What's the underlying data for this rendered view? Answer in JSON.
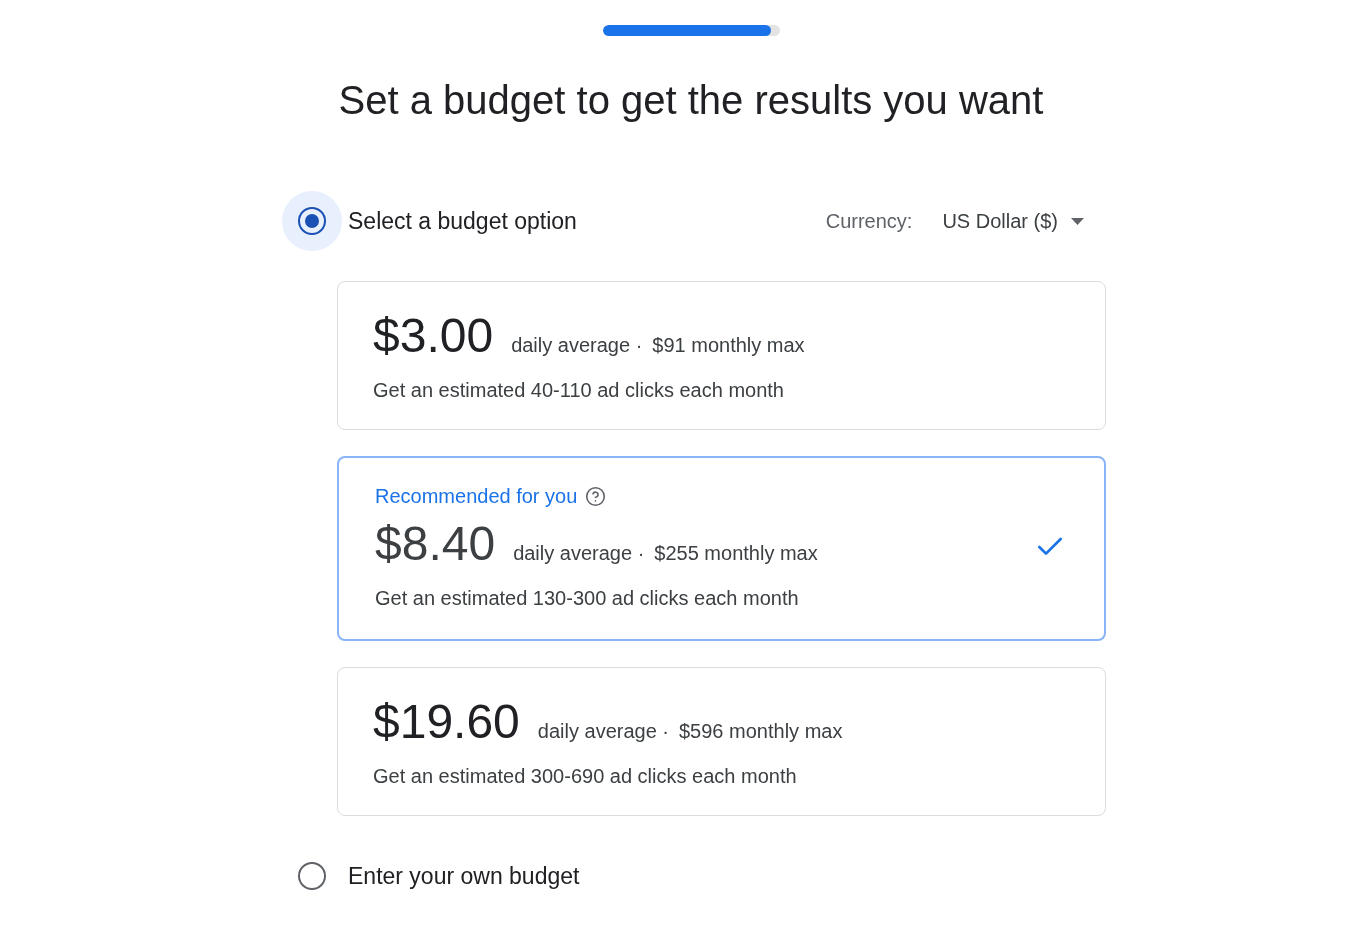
{
  "progress": {
    "level": 0.95
  },
  "title": "Set a budget to get the results you want",
  "budget_modes": [
    {
      "label": "Select a budget option",
      "selected": true,
      "focused": true
    },
    {
      "label": "Enter your own budget",
      "selected": false,
      "focused": false
    }
  ],
  "currency": {
    "label": "Currency:",
    "value": "US Dollar ($)"
  },
  "budget_cards": [
    {
      "price": "$3.00",
      "daily": "daily average ·",
      "monthly": "$91 monthly max",
      "estimate": "Get an estimated 40-110 ad clicks each month",
      "selected": false
    },
    {
      "badge": "Recommended for you",
      "price": "$8.40",
      "daily": "daily average ·",
      "monthly": "$255 monthly max",
      "estimate": "Get an estimated 130-300 ad clicks each month",
      "selected": true
    },
    {
      "price": "$19.60",
      "daily": "daily average ·",
      "monthly": "$596 monthly max",
      "estimate": "Get an estimated 300-690 ad clicks each month",
      "selected": false
    }
  ]
}
